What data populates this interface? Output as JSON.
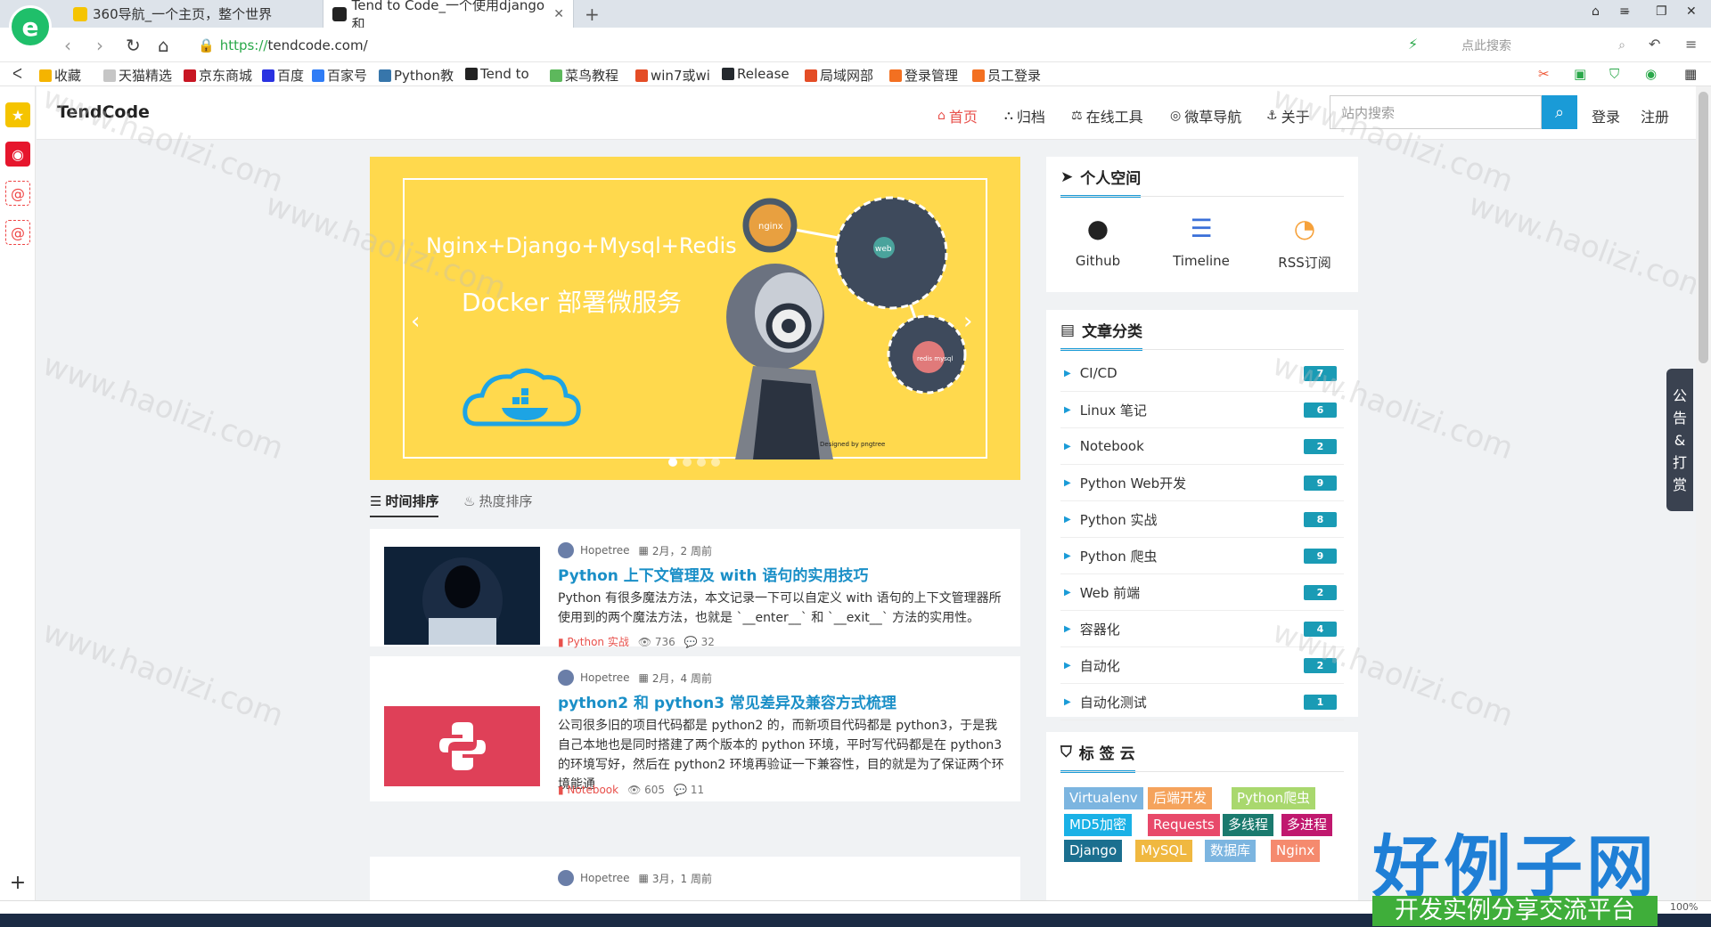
{
  "browser": {
    "tabs": [
      {
        "title": "360导航_一个主页，整个世界"
      },
      {
        "title": "Tend to Code_一个使用django和"
      }
    ],
    "url_prefix": "https://",
    "url_rest": "tendcode.com/",
    "search_placeholder": "点此搜索",
    "zoom": "100%",
    "bookmarks": [
      {
        "label": "收藏",
        "color": "#f5b400"
      },
      {
        "label": "天猫精选",
        "color": "#c6c6c6"
      },
      {
        "label": "京东商城",
        "color": "#c81623"
      },
      {
        "label": "百度",
        "color": "#2932e1"
      },
      {
        "label": "百家号",
        "color": "#2f7cf6"
      },
      {
        "label": "Python教",
        "color": "#3776ab"
      },
      {
        "label": "Tend to",
        "color": "#222222"
      },
      {
        "label": "菜鸟教程",
        "color": "#5db85c"
      },
      {
        "label": "win7或wi",
        "color": "#e44d26"
      },
      {
        "label": "Release",
        "color": "#24292e"
      },
      {
        "label": "局域网部",
        "color": "#e44d26"
      },
      {
        "label": "登录管理",
        "color": "#f37021"
      },
      {
        "label": "员工登录",
        "color": "#f37021"
      }
    ]
  },
  "site": {
    "brand": "TendCode",
    "menu": [
      {
        "icon": "home-icon",
        "label": "首页"
      },
      {
        "icon": "archive-icon",
        "label": "归档"
      },
      {
        "icon": "tools-icon",
        "label": "在线工具"
      },
      {
        "icon": "compass-icon",
        "label": "微草导航"
      },
      {
        "icon": "anchor-icon",
        "label": "关于"
      }
    ],
    "search_placeholder": "站内搜索",
    "login": "登录",
    "register": "注册"
  },
  "banner": {
    "line1": "Nginx+Django+Mysql+Redis",
    "line2": "Docker 部署微服务",
    "node_nginx": "nginx",
    "node_web": "web",
    "node_redis": "redis mysql",
    "credit": "Designed by pngtree"
  },
  "sort_tabs": {
    "time": "时间排序",
    "hot": "热度排序"
  },
  "articles": [
    {
      "author": "Hopetree",
      "date": "2月，2 周前",
      "title": "Python 上下文管理及 with 语句的实用技巧",
      "summary": "Python 有很多魔法方法，本文记录一下可以自定义 with 语句的上下文管理器所使用到的两个魔法方法，也就是 `__enter__` 和 `__exit__` 方法的实用性。",
      "category": "Python 实战",
      "views": "736",
      "comments": "32"
    },
    {
      "author": "Hopetree",
      "date": "2月，4 周前",
      "title": "python2 和 python3 常见差异及兼容方式梳理",
      "summary": "公司很多旧的项目代码都是 python2 的，而新项目代码都是 python3，于是我自己本地也是同时搭建了两个版本的 python 环境，平时写代码都是在 python3 的环境写好，然后在 python2 环境再验证一下兼容性，目的就是为了保证两个环境能通",
      "category": "Notebook",
      "views": "605",
      "comments": "11"
    },
    {
      "author": "Hopetree",
      "date": "3月，1 周前"
    }
  ],
  "personal": {
    "title": "个人空间",
    "items": [
      {
        "label": "Github"
      },
      {
        "label": "Timeline"
      },
      {
        "label": "RSS订阅"
      }
    ]
  },
  "categories": {
    "title": "文章分类",
    "items": [
      {
        "name": "CI/CD",
        "count": "7"
      },
      {
        "name": "Linux 笔记",
        "count": "6"
      },
      {
        "name": "Notebook",
        "count": "2"
      },
      {
        "name": "Python Web开发",
        "count": "9"
      },
      {
        "name": "Python 实战",
        "count": "8"
      },
      {
        "name": "Python 爬虫",
        "count": "9"
      },
      {
        "name": "Web 前端",
        "count": "2"
      },
      {
        "name": "容器化",
        "count": "4"
      },
      {
        "name": "自动化",
        "count": "2"
      },
      {
        "name": "自动化测试",
        "count": "1"
      }
    ]
  },
  "tags": {
    "title": "标 签 云",
    "items": [
      {
        "label": "Virtualenv",
        "color": "#7cb5e0"
      },
      {
        "label": "后端开发",
        "color": "#f5a35c"
      },
      {
        "label": "Python爬虫",
        "color": "#a9d86e"
      },
      {
        "label": "MD5加密",
        "color": "#1ab1e6"
      },
      {
        "label": "Requests",
        "color": "#e8496a"
      },
      {
        "label": "多线程",
        "color": "#1b7a6e"
      },
      {
        "label": "多进程",
        "color": "#c0186e"
      },
      {
        "label": "Django",
        "color": "#1b6f8f"
      },
      {
        "label": "MySQL",
        "color": "#f0b840"
      },
      {
        "label": "数据库",
        "color": "#7cb5e0"
      },
      {
        "label": "Nginx",
        "color": "#f58a6e"
      }
    ]
  },
  "notice_float": [
    "公",
    "告",
    "&",
    "打",
    "赏"
  ],
  "watermark": {
    "big": "好例子网",
    "small": "开发实例分享交流平台",
    "site": "www.haolizi.com"
  }
}
